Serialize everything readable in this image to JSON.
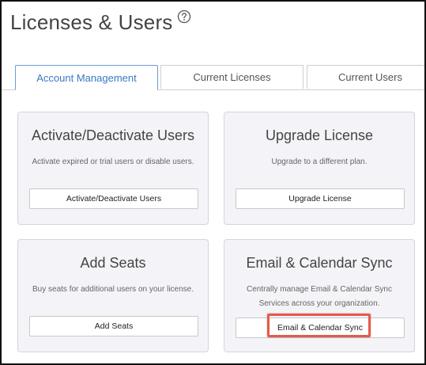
{
  "header": {
    "title": "Licenses & Users",
    "help_icon": "question-circle-icon"
  },
  "tabs": [
    {
      "label": "Account Management",
      "active": true
    },
    {
      "label": "Current Licenses",
      "active": false
    },
    {
      "label": "Current Users",
      "active": false
    }
  ],
  "cards": [
    {
      "title": "Activate/Deactivate Users",
      "description": "Activate expired or trial users or disable users.",
      "button": "Activate/Deactivate Users"
    },
    {
      "title": "Upgrade License",
      "description": "Upgrade to a different plan.",
      "button": "Upgrade License"
    },
    {
      "title": "Add Seats",
      "description": "Buy seats for additional users on your license.",
      "button": "Add Seats"
    },
    {
      "title": "Email & Calendar Sync",
      "description": "Centrally manage Email & Calendar Sync Services across your organization.",
      "button": "Email & Calendar Sync"
    }
  ],
  "colors": {
    "accent": "#3a79c4",
    "highlight": "#e8594a",
    "card_bg": "#f4f4f8"
  }
}
